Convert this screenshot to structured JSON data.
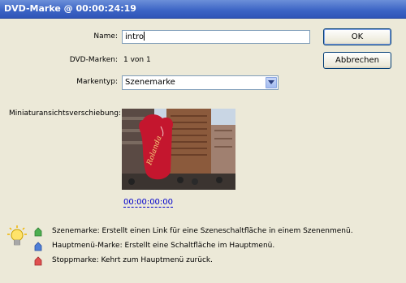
{
  "window": {
    "title": "DVD-Marke @ 00:00:24:19"
  },
  "form": {
    "name_label": "Name:",
    "name_value": "intro",
    "dvd_marks_label": "DVD-Marken:",
    "dvd_marks_value": "1 von 1",
    "mark_type_label": "Markentyp:",
    "mark_type_value": "Szenemarke",
    "thumbnail_label": "Miniaturansichtsverschiebung:",
    "thumbnail_timecode": "00:00:00:00"
  },
  "buttons": {
    "ok": "OK",
    "cancel": "Abbrechen"
  },
  "help": {
    "items": [
      {
        "text": "Szenemarke: Erstellt einen Link für eine Szeneschaltfläche in einem Szenenmenü.",
        "color": "#4caf50",
        "icon": "scene-marker-icon"
      },
      {
        "text": "Hauptmenü-Marke: Erstellt eine Schaltfläche im Hauptmenü.",
        "color": "#4f7fd6",
        "icon": "main-menu-marker-icon"
      },
      {
        "text": "Stoppmarke: Kehrt zum Hauptmenü zurück.",
        "color": "#e05050",
        "icon": "stop-marker-icon"
      }
    ]
  },
  "thumbnail_sign_text": "Rolanda"
}
